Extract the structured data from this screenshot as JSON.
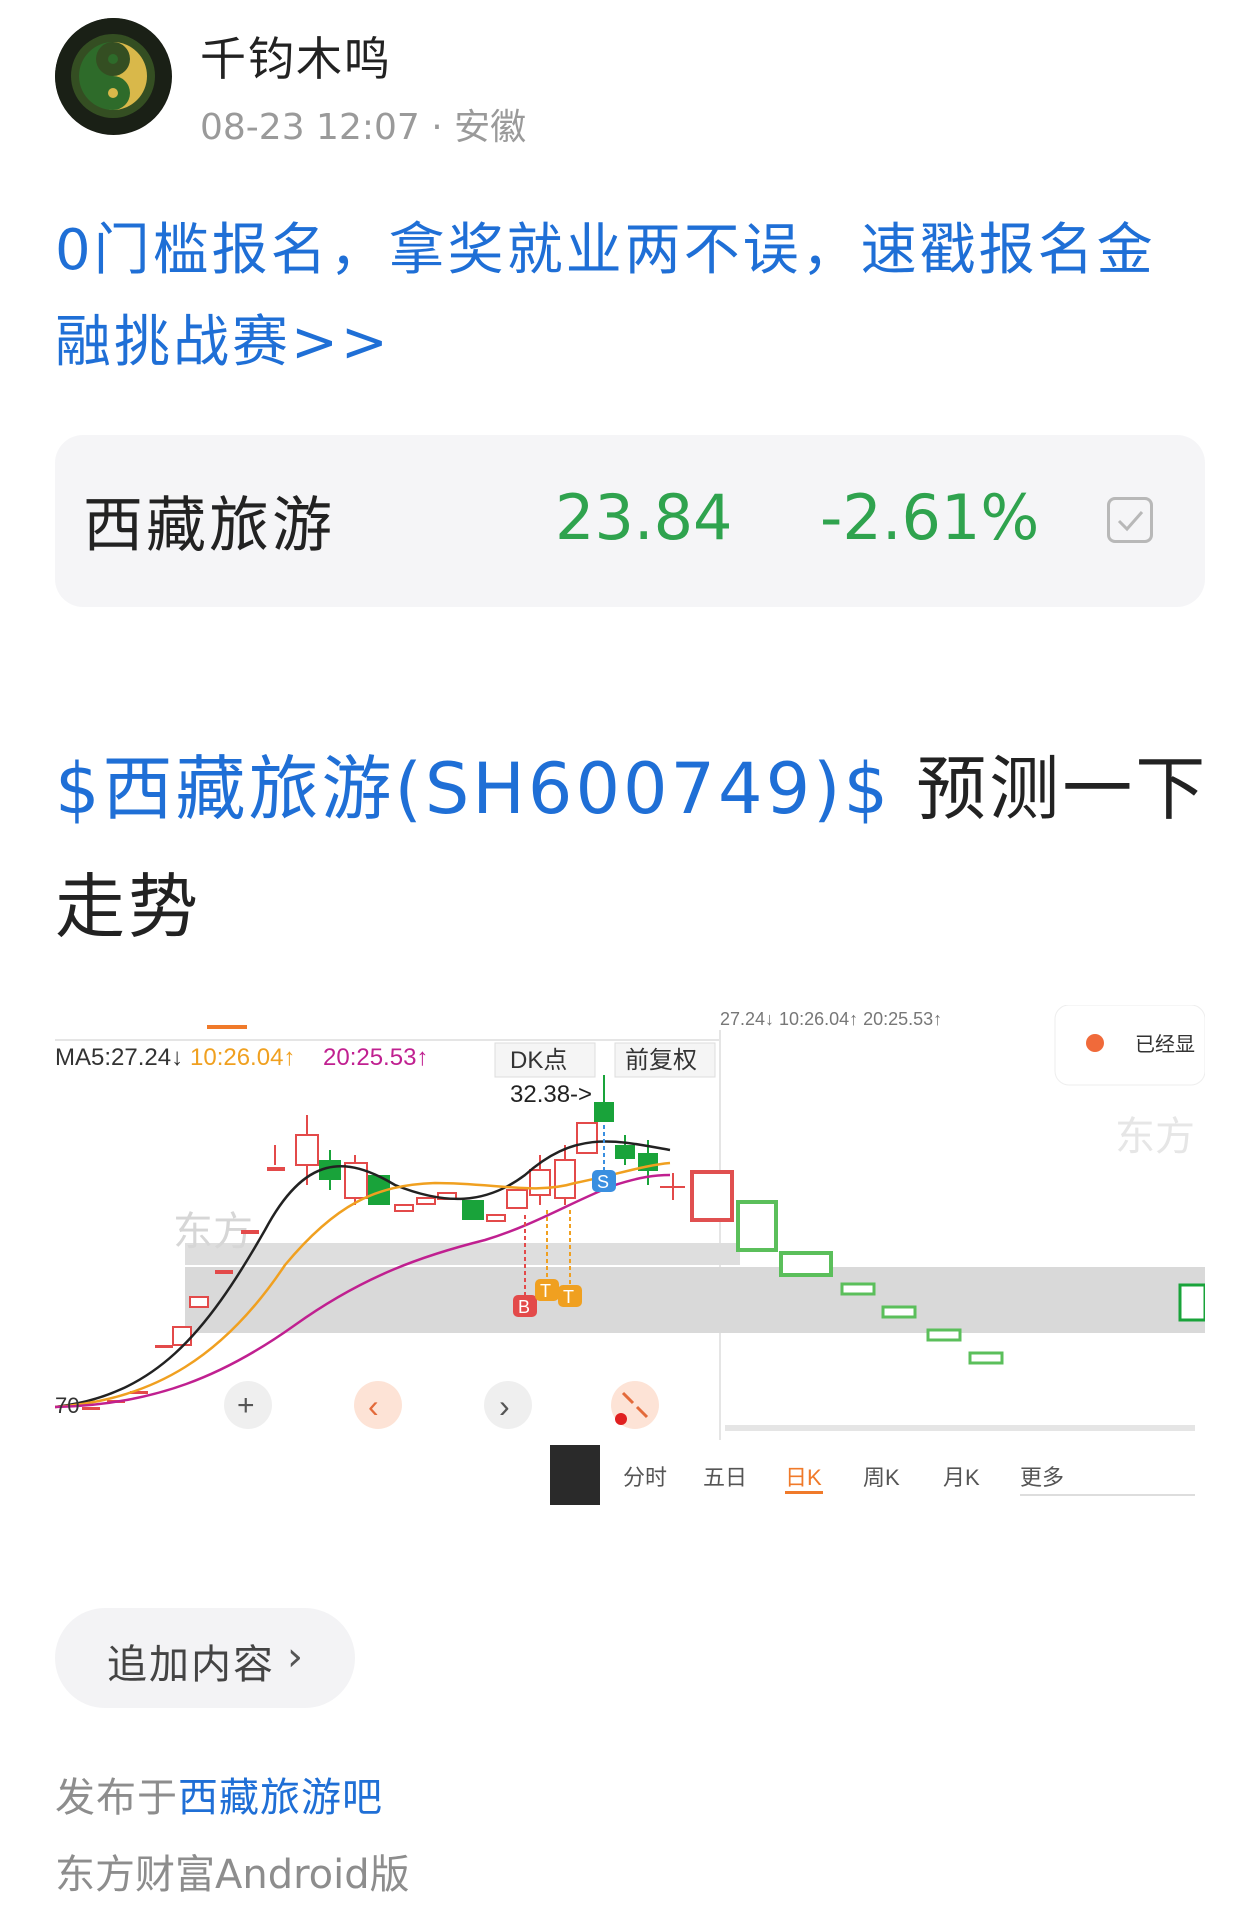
{
  "author": {
    "name": "千钧木鸣",
    "time": "08-23 12:07",
    "separator": "·",
    "location": "安徽"
  },
  "promo": {
    "text": "0门槛报名，拿奖就业两不误，速戳报名金融挑战赛>>"
  },
  "stock_card": {
    "name": "西藏旅游",
    "price": "23.84",
    "change": "-2.61%"
  },
  "post": {
    "stock_link": "$西藏旅游(SH600749)$",
    "text": "预测一下走势"
  },
  "chart": {
    "ma_legend_left": "MA5:27.24↓",
    "ma_legend_mid": "10:26.04↑",
    "ma_legend_right": "20:25.53↑",
    "ma_legend_small": "27.24↓ 10:26.04↑ 20:25.53↑",
    "dk_button": "DK点",
    "fq_button": "前复权",
    "peak_label": "32.38->",
    "axis_label": "70",
    "signal_b": "B",
    "signal_t": "T",
    "signal_s": "S",
    "watermark": "东方",
    "notice": "已经显",
    "tabs": [
      "分时",
      "五日",
      "日K",
      "周K",
      "月K",
      "更多"
    ],
    "active_tab": "日K",
    "colors": {
      "up": "#e34a4a",
      "down": "#19a33a",
      "ma5": "#222222",
      "ma10": "#f0a020",
      "ma20": "#c02090",
      "prediction_down": "#5bbf5b",
      "prediction_up": "#e05050"
    }
  },
  "actions": {
    "add_content": "追加内容",
    "chevron": "›"
  },
  "footer": {
    "posted_prefix": "发布于",
    "forum": "西藏旅游吧",
    "source": "东方财富Android版"
  }
}
